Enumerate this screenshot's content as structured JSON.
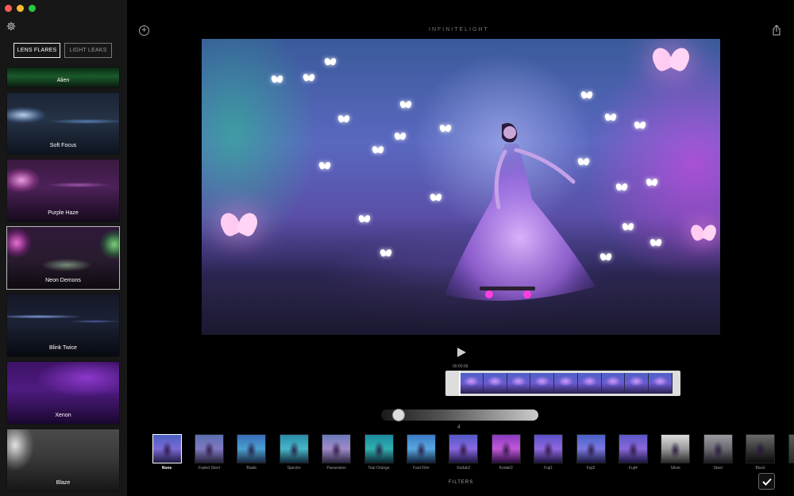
{
  "window": {
    "traffic_colors": [
      "#ff5f57",
      "#febc2e",
      "#28c840"
    ]
  },
  "sidebar": {
    "tabs": [
      {
        "label": "LENS FLARES",
        "active": true
      },
      {
        "label": "LIGHT LEAKS",
        "active": false
      }
    ],
    "presets": [
      {
        "label": "Alien"
      },
      {
        "label": "Soft Focus"
      },
      {
        "label": "Purple Haze"
      },
      {
        "label": "Neon Demons",
        "selected": true
      },
      {
        "label": "Blink Twice"
      },
      {
        "label": "Xenon"
      },
      {
        "label": "Blaze"
      }
    ]
  },
  "header": {
    "brand": "INFINITELIGHT"
  },
  "player": {
    "timecode": "00:00:09"
  },
  "intensity": {
    "value": "4",
    "level": 0.05
  },
  "filters": {
    "title": "FILTERS",
    "items": [
      {
        "label": "None",
        "selected": true
      },
      {
        "label": "Faded Steel"
      },
      {
        "label": "Blade"
      },
      {
        "label": "Spectre"
      },
      {
        "label": "Panavision"
      },
      {
        "label": "Teal Orange"
      },
      {
        "label": "Fast Film"
      },
      {
        "label": "Kodak2"
      },
      {
        "label": "Kodak3"
      },
      {
        "label": "Fuji1"
      },
      {
        "label": "Fuji2"
      },
      {
        "label": "Fuji4"
      },
      {
        "label": "Silver"
      },
      {
        "label": "Steel"
      },
      {
        "label": "Black"
      }
    ]
  },
  "icons": {
    "settings": "gear-icon",
    "add": "plus-circle-icon",
    "share": "share-icon",
    "play": "play-icon",
    "confirm": "checkmark-icon"
  }
}
